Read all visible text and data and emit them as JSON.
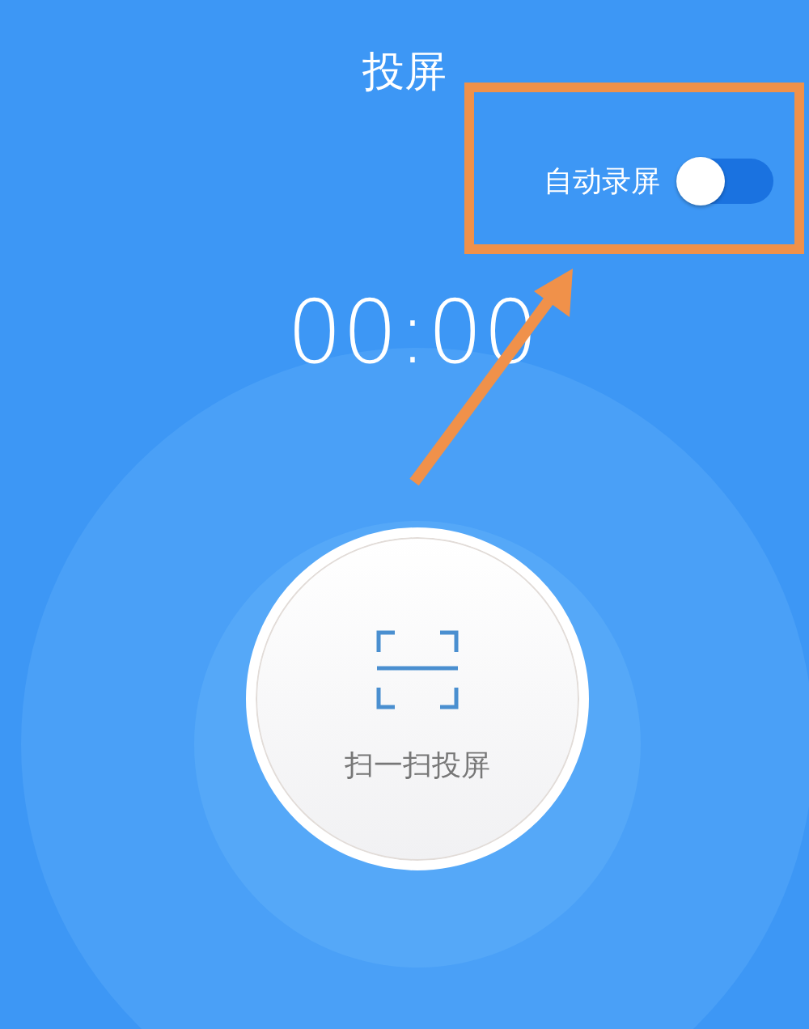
{
  "title": "投屏",
  "auto_record": {
    "label": "自动录屏",
    "on": false
  },
  "timer": "00:00",
  "scan_button": {
    "label": "扫一扫投屏"
  }
}
